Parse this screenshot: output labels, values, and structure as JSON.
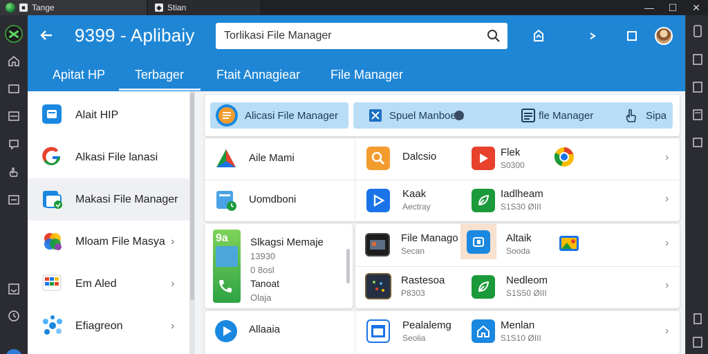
{
  "os_tabs": [
    {
      "label": "Tange"
    },
    {
      "label": "Stian"
    }
  ],
  "window_controls": {
    "minimize": "—",
    "maximize": "☐",
    "close": "✕"
  },
  "app": {
    "title": "9399 - Aplibaiy",
    "search": {
      "value": "Torlikasi File Manager"
    },
    "tabs": [
      "Apitat HP",
      "Terbager",
      "Ftait Annagiear",
      "File Manager"
    ],
    "active_tab": 1
  },
  "sidebar": {
    "items": [
      {
        "label": "Alait HIP",
        "icon": "file-manager-icon",
        "chevron": ""
      },
      {
        "label": "Alkasi File lanasi",
        "icon": "google-icon",
        "chevron": ""
      },
      {
        "label": "Makasi File Manager",
        "icon": "folder-icon",
        "chevron": ""
      },
      {
        "label": "Mloam File Masya",
        "icon": "photos-icon",
        "chevron": "›"
      },
      {
        "label": "Em Aled",
        "icon": "grid-app-icon",
        "chevron": "›"
      },
      {
        "label": "Efiagreon",
        "icon": "molecule-icon",
        "chevron": "›"
      }
    ]
  },
  "main": {
    "pill_bar": {
      "primary": "Alicasi File Manager",
      "secondary": {
        "left": "Spuel Manboelt:",
        "middle": "fle Manager",
        "right": "Sipa"
      }
    },
    "apps_card1": {
      "left": [
        {
          "label": "Aile Mami",
          "icon": "drive-triangle-icon"
        },
        {
          "label": "Uomdboni",
          "icon": "file-clock-icon"
        }
      ],
      "mid": [
        {
          "title": "Dalcsio",
          "sub": "",
          "icon": "search-app-icon"
        },
        {
          "title": "Kaak",
          "sub": "Aectray",
          "icon": "play-store-icon"
        }
      ],
      "right": [
        {
          "title": "Flek",
          "sub": "S0300",
          "icon": "play-red-icon",
          "icon2": "chrome-like-icon"
        },
        {
          "title": "Iadlheam",
          "sub": "S1S30 ØIII",
          "icon": "leaf-green-icon"
        }
      ]
    },
    "featured": {
      "title": "Slkagsi Memaje",
      "lines": [
        "13930",
        "0 8osl",
        "Tanoat",
        "Olaja"
      ],
      "badge": "9a"
    },
    "apps_card2": {
      "mid": [
        {
          "title": "File Manago",
          "sub": "Secan",
          "icon": "screen-app-icon"
        },
        {
          "title": "Rastesoa",
          "sub": "P8303",
          "icon": "dots-app-icon"
        }
      ],
      "right": [
        {
          "title": "Altaik",
          "sub": "Sooda",
          "icon": "blue-square-icon",
          "icon2": "gallery-icon"
        },
        {
          "title": "Nedleom",
          "sub": "S1S50 ØIII",
          "icon": "leaf-green-icon"
        }
      ]
    },
    "bottom_card": {
      "left": {
        "label": "Allaaia",
        "icon": "play-circle-icon"
      },
      "mid": {
        "title": "Pealalemg",
        "sub": "Seolia",
        "icon": "window-app-icon"
      },
      "right": {
        "title": "Menlan",
        "sub": "S1S10 ØIII",
        "icon": "home-blue-icon"
      }
    }
  },
  "colors": {
    "appbar": "#1f86d6",
    "pill": "#b9ddf6",
    "accent_green": "#1a9a3a",
    "accent_red": "#e8412c"
  }
}
